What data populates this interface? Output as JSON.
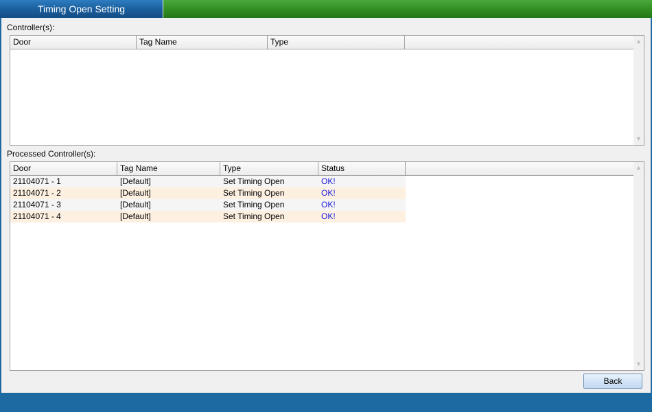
{
  "window": {
    "title": "Timing Open Setting"
  },
  "controllers": {
    "label": "Controller(s):",
    "columns": [
      "Door",
      "Tag Name",
      "Type"
    ],
    "rows": []
  },
  "processed": {
    "label": "Processed Controller(s):",
    "columns": [
      "Door",
      "Tag Name",
      "Type",
      "Status"
    ],
    "rows": [
      {
        "door": "21104071 - 1",
        "tag_name": "[Default]",
        "type": "Set Timing Open",
        "status": "OK!"
      },
      {
        "door": "21104071 - 2",
        "tag_name": "[Default]",
        "type": "Set Timing Open",
        "status": "OK!"
      },
      {
        "door": "21104071 - 3",
        "tag_name": "[Default]",
        "type": "Set Timing Open",
        "status": "OK!"
      },
      {
        "door": "21104071 - 4",
        "tag_name": "[Default]",
        "type": "Set Timing Open",
        "status": "OK!"
      }
    ]
  },
  "buttons": {
    "back": "Back"
  },
  "icons": {
    "scroll_up": "chevron-up-icon",
    "scroll_down": "chevron-down-icon"
  },
  "colors": {
    "title_blue": "#1a5d9b",
    "title_green": "#2f8a1f",
    "status_ok": "#1a1adc",
    "row_alt": "#fdf0e0"
  }
}
